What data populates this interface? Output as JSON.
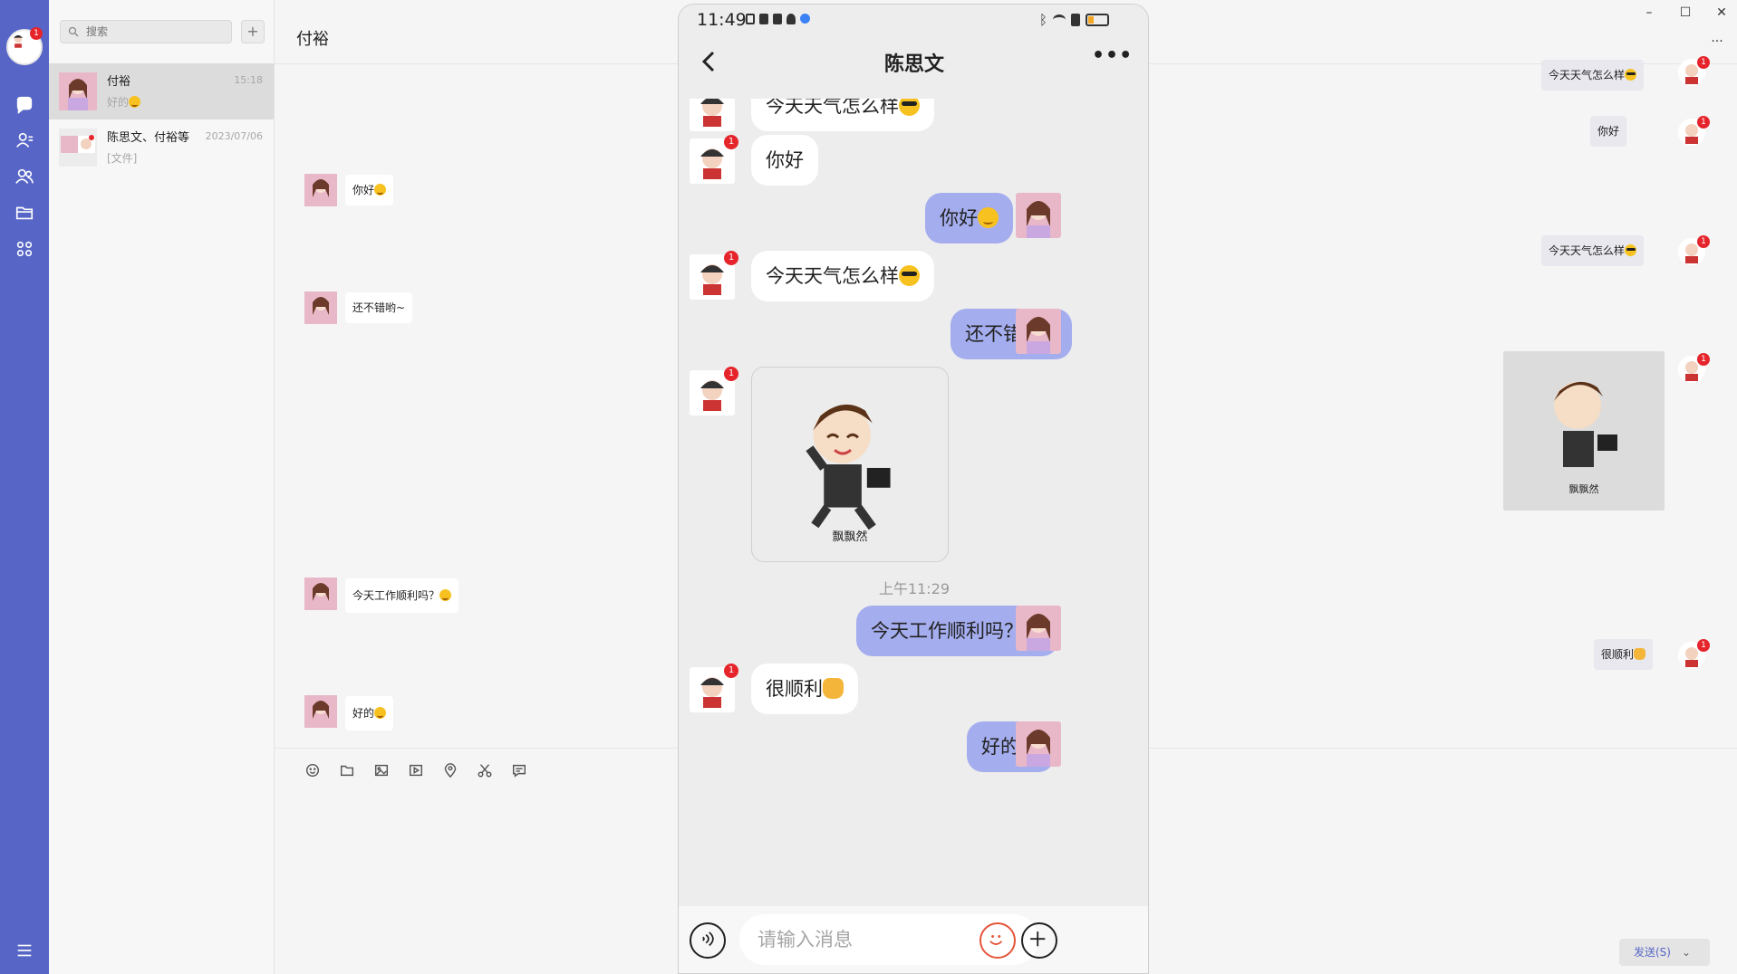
{
  "rail": {
    "badge": "1",
    "nav_icons": [
      "chat-icon",
      "contacts-icon",
      "group-icon",
      "folder-icon",
      "apps-icon"
    ],
    "menu_icon": "hamburger-icon",
    "accent": "#5766c6"
  },
  "sessions": {
    "search_placeholder": "搜索",
    "add_label": "+",
    "items": [
      {
        "name": "付裕",
        "time": "15:18",
        "preview": "好的"
      },
      {
        "name": "陈思文、付裕等",
        "time": "2023/07/06",
        "preview": "[文件]"
      }
    ]
  },
  "chat": {
    "title": "付裕",
    "more": "...",
    "window_controls": {
      "minimize": "–",
      "maximize": "☐",
      "close": "✕"
    },
    "left_messages": [
      {
        "text": "你好"
      },
      {
        "text": "还不错哟~"
      },
      {
        "text": "今天工作顺利吗？"
      },
      {
        "text": "好的"
      }
    ],
    "right_messages": [
      {
        "text": "今天天气怎么样"
      },
      {
        "text": "你好"
      },
      {
        "text": "今天天气怎么样"
      },
      {
        "sticker_caption": "飘飘然"
      },
      {
        "text": "很顺利"
      }
    ],
    "right_badge": "1",
    "toolbar_icons": [
      "emoji-icon",
      "folder-icon",
      "image-icon",
      "video-icon",
      "location-icon",
      "scissors-icon",
      "message-icon"
    ],
    "send_label": "发送(S)"
  },
  "phone": {
    "clock": "11:49",
    "title": "陈思文",
    "more": "•••",
    "badge": "1",
    "messages": [
      {
        "side": "left",
        "text": "今天天气怎么样"
      },
      {
        "side": "left",
        "text": "你好"
      },
      {
        "side": "right",
        "text": "你好"
      },
      {
        "side": "left",
        "text": "今天天气怎么样"
      },
      {
        "side": "right",
        "text": "还不错哟~"
      },
      {
        "side": "left",
        "sticker_caption": "飘飘然"
      },
      {
        "time": "上午11:29"
      },
      {
        "side": "right",
        "text": "今天工作顺利吗？"
      },
      {
        "side": "left",
        "text": "很顺利"
      },
      {
        "side": "right",
        "text": "好的"
      }
    ],
    "input_placeholder": "请输入消息"
  }
}
